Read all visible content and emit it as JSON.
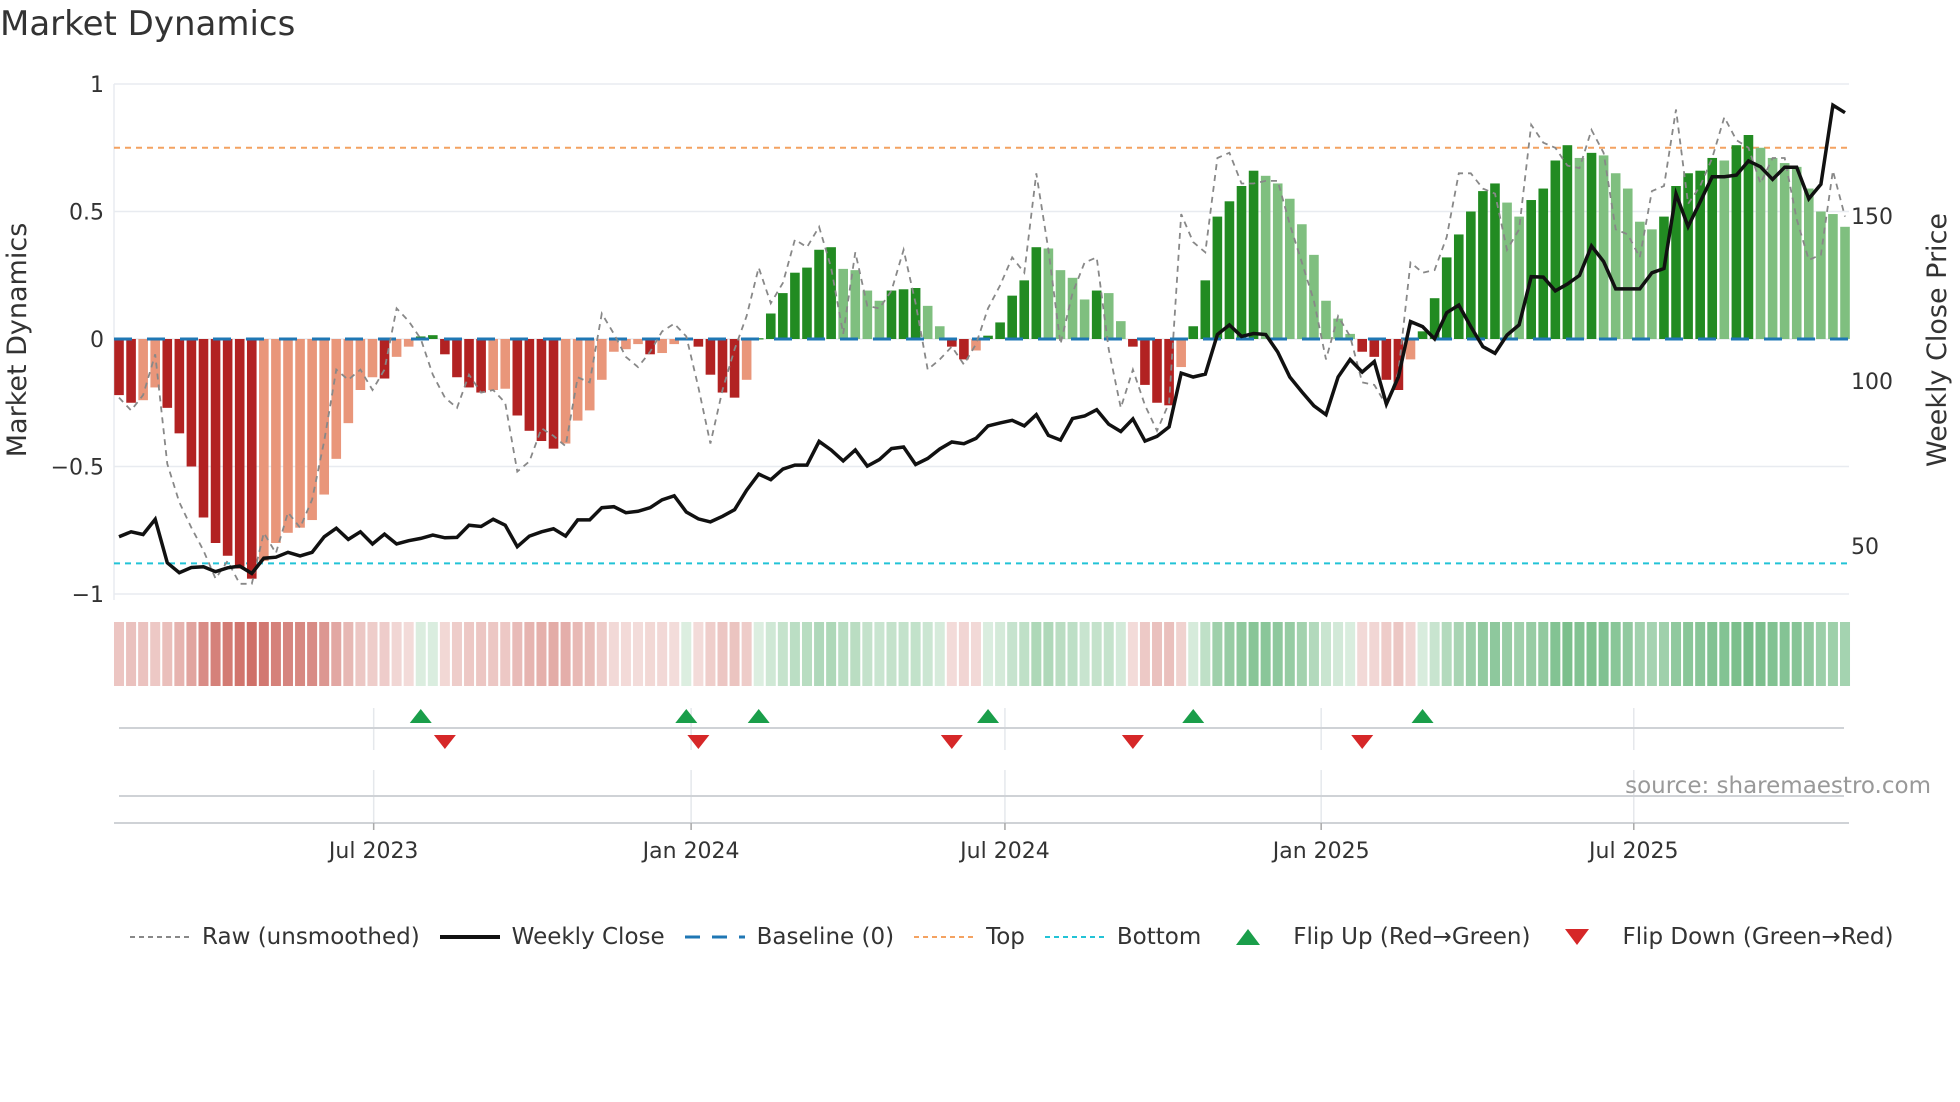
{
  "title": "Market Dynamics",
  "source": "source: sharemaestro.com",
  "legend": {
    "raw": "Raw (unsmoothed)",
    "close": "Weekly Close",
    "baseline": "Baseline (0)",
    "top": "Top",
    "bottom": "Bottom",
    "flip_up": "Flip Up (Red→Green)",
    "flip_down": "Flip Down (Green→Red)"
  },
  "colors": {
    "pos_strong": "#228b22",
    "pos_weak": "#7fbf7f",
    "neg_strong": "#b22222",
    "neg_weak": "#e9967a",
    "raw": "#888888",
    "close": "#111111",
    "baseline": "#1f77b4",
    "top": "#f4a261",
    "bottom": "#22c3d6",
    "flip_up": "#1a9e4a",
    "flip_down": "#d62728"
  },
  "chart_data": {
    "type": "bar+line",
    "title": "Market Dynamics",
    "ylabel": "Market Dynamics",
    "ylabel_right": "Weekly Close Price",
    "ylim": [
      -1,
      1
    ],
    "ylim_right": [
      35.5,
      190
    ],
    "yticks": [
      {
        "v": 1,
        "label": "1"
      },
      {
        "v": 0.5,
        "label": "0.5"
      },
      {
        "v": 0,
        "label": "0"
      },
      {
        "v": -0.5,
        "label": "−0.5"
      },
      {
        "v": -1,
        "label": "−1"
      }
    ],
    "yticks_right": [
      {
        "v": 150,
        "label": "150"
      },
      {
        "v": 100,
        "label": "100"
      },
      {
        "v": 50,
        "label": "50"
      }
    ],
    "xticks": [
      {
        "week": 21.1,
        "label": "Jul 2023"
      },
      {
        "week": 47.4,
        "label": "Jan 2024"
      },
      {
        "week": 73.4,
        "label": "Jul 2024"
      },
      {
        "week": 99.6,
        "label": "Jan 2025"
      },
      {
        "week": 125.5,
        "label": "Jul 2025"
      }
    ],
    "top_level": 0.75,
    "bottom_level": -0.88,
    "baseline": 0,
    "grid": true,
    "legend_position": "bottom",
    "dynamics": [
      -0.22,
      -0.25,
      -0.24,
      -0.19,
      -0.27,
      -0.37,
      -0.5,
      -0.7,
      -0.8,
      -0.85,
      -0.9,
      -0.94,
      -0.87,
      -0.8,
      -0.76,
      -0.74,
      -0.71,
      -0.61,
      -0.47,
      -0.33,
      -0.2,
      -0.15,
      -0.155,
      -0.07,
      -0.03,
      0.01,
      0.015,
      -0.06,
      -0.15,
      -0.19,
      -0.21,
      -0.2,
      -0.195,
      -0.3,
      -0.36,
      -0.4,
      -0.43,
      -0.41,
      -0.32,
      -0.28,
      -0.16,
      -0.05,
      -0.04,
      -0.02,
      -0.06,
      -0.055,
      -0.02,
      0.002,
      -0.03,
      -0.14,
      -0.21,
      -0.23,
      -0.16,
      0.003,
      0.1,
      0.18,
      0.26,
      0.28,
      0.35,
      0.36,
      0.275,
      0.27,
      0.19,
      0.15,
      0.19,
      0.195,
      0.2,
      0.13,
      0.05,
      -0.03,
      -0.08,
      -0.045,
      0.013,
      0.065,
      0.17,
      0.23,
      0.36,
      0.355,
      0.27,
      0.24,
      0.155,
      0.19,
      0.18,
      0.07,
      -0.03,
      -0.18,
      -0.25,
      -0.26,
      -0.11,
      0.05,
      0.23,
      0.48,
      0.54,
      0.6,
      0.66,
      0.64,
      0.61,
      0.55,
      0.45,
      0.33,
      0.15,
      0.08,
      0.02,
      -0.05,
      -0.07,
      -0.16,
      -0.2,
      -0.08,
      0.03,
      0.16,
      0.32,
      0.41,
      0.5,
      0.58,
      0.61,
      0.535,
      0.48,
      0.545,
      0.59,
      0.7,
      0.76,
      0.71,
      0.73,
      0.72,
      0.65,
      0.59,
      0.46,
      0.43,
      0.48,
      0.6,
      0.65,
      0.66,
      0.71,
      0.7,
      0.76,
      0.8,
      0.75,
      0.71,
      0.69,
      0.675,
      0.59,
      0.5,
      0.49,
      0.44
    ],
    "raw": [
      -0.23,
      -0.28,
      -0.22,
      -0.06,
      -0.49,
      -0.64,
      -0.74,
      -0.83,
      -0.94,
      -0.87,
      -0.96,
      -0.96,
      -0.76,
      -0.84,
      -0.68,
      -0.74,
      -0.63,
      -0.4,
      -0.12,
      -0.16,
      -0.12,
      -0.2,
      -0.12,
      0.12,
      0.07,
      0,
      -0.14,
      -0.23,
      -0.27,
      -0.14,
      -0.21,
      -0.2,
      -0.25,
      -0.52,
      -0.48,
      -0.35,
      -0.38,
      -0.42,
      -0.15,
      -0.17,
      0.1,
      0.02,
      -0.07,
      -0.11,
      -0.05,
      0.03,
      0.06,
      0.01,
      -0.19,
      -0.41,
      -0.2,
      -0.04,
      0.09,
      0.28,
      0.14,
      0.22,
      0.39,
      0.36,
      0.44,
      0.28,
      0.02,
      0.34,
      0.13,
      0.12,
      0.19,
      0.35,
      0.14,
      -0.12,
      -0.08,
      -0.03,
      -0.1,
      -0.02,
      0.12,
      0.21,
      0.32,
      0.26,
      0.65,
      0.35,
      -0.02,
      0.18,
      0.3,
      0.32,
      -0.04,
      -0.27,
      -0.12,
      -0.26,
      -0.36,
      -0.25,
      0.49,
      0.38,
      0.34,
      0.71,
      0.73,
      0.61,
      0.61,
      0.62,
      0.62,
      0.45,
      0.3,
      0.15,
      -0.08,
      0.09,
      0.01,
      -0.17,
      -0.18,
      -0.26,
      -0.13,
      0.3,
      0.26,
      0.27,
      0.4,
      0.65,
      0.65,
      0.59,
      0.57,
      0.35,
      0.43,
      0.84,
      0.77,
      0.75,
      0.68,
      0.67,
      0.82,
      0.73,
      0.43,
      0.41,
      0.32,
      0.58,
      0.6,
      0.9,
      0.53,
      0.6,
      0.71,
      0.87,
      0.78,
      0.75,
      0.61,
      0.71,
      0.71,
      0.47,
      0.31,
      0.33,
      0.66,
      0.48
    ],
    "close": [
      52.8,
      54.3,
      53.5,
      58.1,
      44.9,
      41.9,
      43.5,
      43.7,
      42.2,
      43.4,
      43.9,
      41.7,
      46.3,
      46.6,
      48.1,
      47.0,
      48.1,
      52.8,
      55.4,
      52.0,
      54.3,
      50.6,
      53.6,
      50.6,
      51.6,
      52.3,
      53.3,
      52.5,
      52.6,
      56.3,
      55.9,
      58.1,
      56.3,
      49.8,
      53.0,
      54.3,
      55.2,
      53.0,
      57.9,
      57.9,
      61.6,
      61.9,
      60.1,
      60.5,
      61.6,
      64.0,
      65.2,
      60.3,
      58.2,
      57.3,
      59.0,
      61.0,
      66.9,
      71.8,
      70.1,
      73.3,
      74.5,
      74.5,
      81.7,
      79.1,
      75.8,
      79.1,
      74.2,
      76.2,
      79.5,
      80.0,
      74.7,
      76.5,
      79.4,
      81.5,
      81.0,
      82.6,
      86.4,
      87.3,
      88.1,
      86.4,
      89.8,
      83.5,
      82.1,
      88.6,
      89.4,
      91.3,
      86.9,
      84.7,
      88.5,
      81.8,
      83.2,
      86.1,
      102.4,
      101.2,
      102.1,
      114.1,
      117.0,
      113.5,
      114.4,
      114.1,
      108.8,
      101.2,
      96.7,
      92.5,
      89.8,
      101.2,
      106.5,
      102.7,
      105.9,
      93.0,
      101.2,
      118,
      116.5,
      112.8,
      120.7,
      123,
      116.5,
      110.4,
      108.4,
      113.9,
      117,
      131.6,
      131.5,
      127.3,
      129.4,
      132,
      140.9,
      136.2,
      127.9,
      127.9,
      127.9,
      132.8,
      134.1,
      156.7,
      146.8,
      154.3,
      161.9,
      161.9,
      162.4,
      166.7,
      164.9,
      161.1,
      164.8,
      164.8,
      155.2,
      159.6,
      183.6,
      181.3
    ]
  }
}
